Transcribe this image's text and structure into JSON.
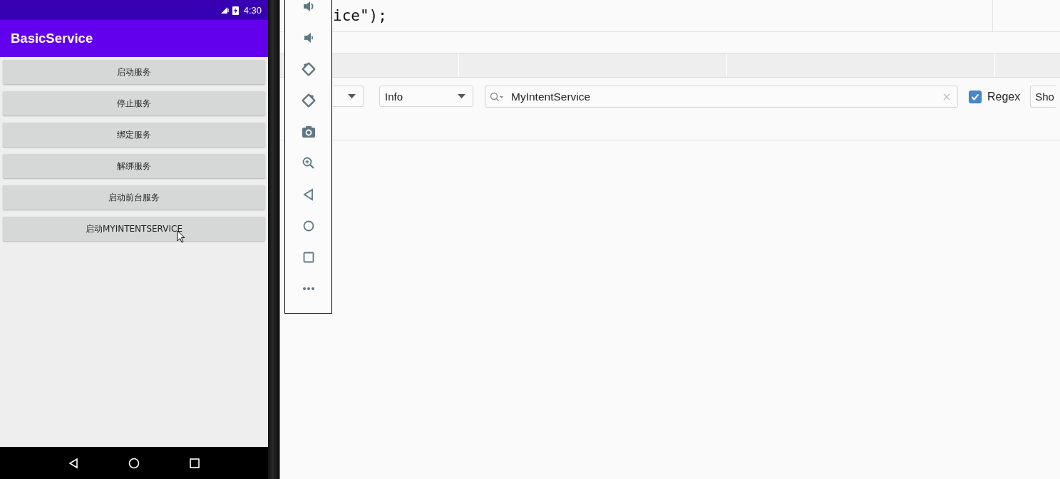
{
  "phone": {
    "status_bar": {
      "time": "4:30"
    },
    "app_bar": {
      "title": "BasicService"
    },
    "buttons": [
      {
        "label": "启动服务"
      },
      {
        "label": "停止服务"
      },
      {
        "label": "绑定服务"
      },
      {
        "label": "解绑服务"
      },
      {
        "label": "启动前台服务"
      },
      {
        "label": "启动MYINTENTSERVICE"
      }
    ]
  },
  "editor": {
    "code_fragments": [
      "ice\");"
    ]
  },
  "logcat": {
    "level_dropdown": {
      "value": "Info"
    },
    "search": {
      "value": "MyIntentService"
    },
    "regex": {
      "label": "Regex",
      "checked": true
    },
    "show_button": {
      "label": "Sho"
    }
  }
}
